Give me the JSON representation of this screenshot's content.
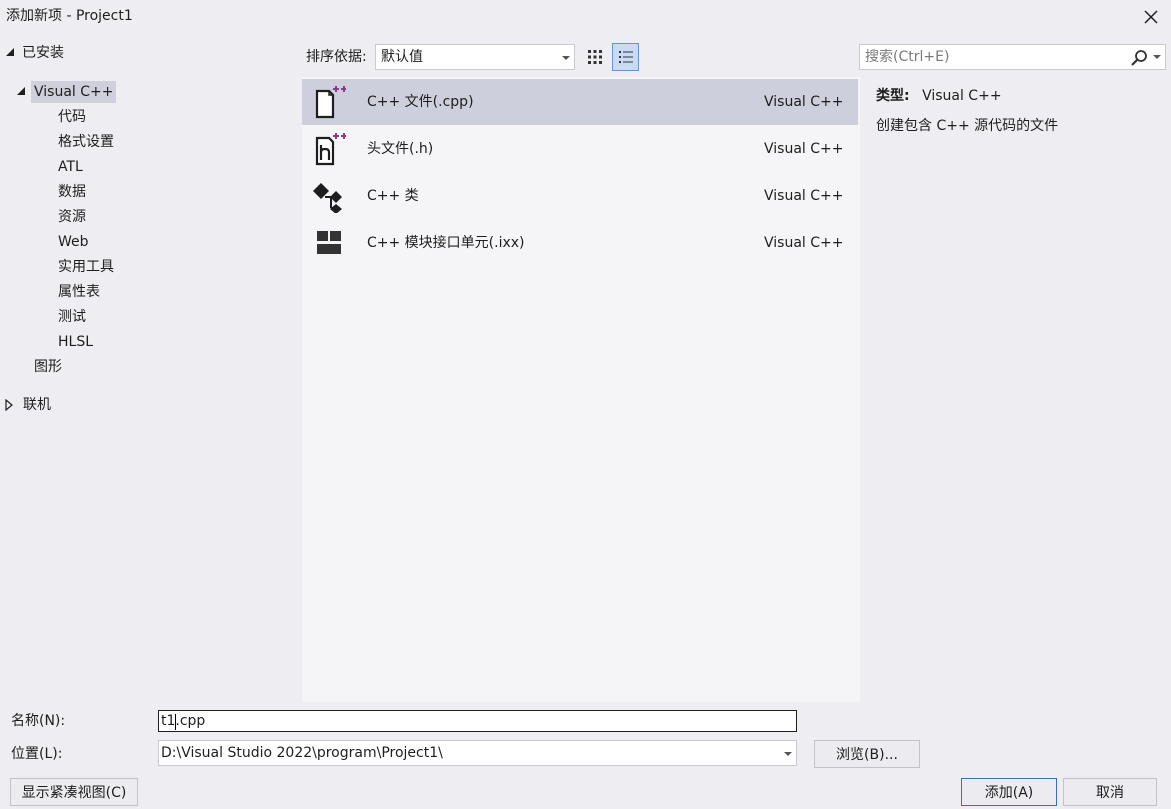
{
  "window": {
    "title": "添加新项 - Project1",
    "close_icon": "close-icon"
  },
  "tree": {
    "installed": "已安装",
    "visual_cpp": "Visual C++",
    "children": [
      "代码",
      "格式设置",
      "ATL",
      "数据",
      "资源",
      "Web",
      "实用工具",
      "属性表",
      "测试",
      "HLSL"
    ],
    "graphics": "图形",
    "online": "联机"
  },
  "toolbar": {
    "sort_label": "排序依据:",
    "sort_value": "默认值",
    "grid_view_icon": "grid-view-icon",
    "list_view_icon": "list-view-icon"
  },
  "templates": [
    {
      "name": "C++ 文件(.cpp)",
      "type": "Visual C++",
      "icon": "cpp-file-icon",
      "selected": true
    },
    {
      "name": "头文件(.h)",
      "type": "Visual C++",
      "icon": "header-file-icon",
      "selected": false
    },
    {
      "name": "C++ 类",
      "type": "Visual C++",
      "icon": "cpp-class-icon",
      "selected": false
    },
    {
      "name": "C++ 模块接口单元(.ixx)",
      "type": "Visual C++",
      "icon": "module-unit-icon",
      "selected": false
    }
  ],
  "search": {
    "placeholder": "搜索(Ctrl+E)"
  },
  "details": {
    "type_label": "类型:",
    "type_value": "Visual C++",
    "description": "创建包含 C++ 源代码的文件"
  },
  "form": {
    "name_label": "名称(N):",
    "name_value": "t1.cpp",
    "location_label": "位置(L):",
    "location_value": "D:\\Visual Studio 2022\\program\\Project1\\",
    "browse": "浏览(B)...",
    "compact_view": "显示紧凑视图(C)",
    "add": "添加(A)",
    "cancel": "取消"
  },
  "colors": {
    "selection": "#cdcfdc",
    "accent": "#3c6fb7",
    "plus": "#8a3a8c"
  }
}
